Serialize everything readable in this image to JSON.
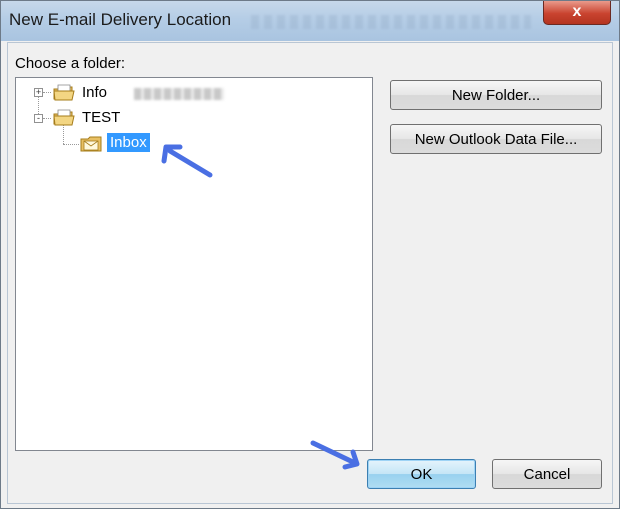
{
  "window": {
    "title": "New E-mail Delivery Location",
    "close_label": "x"
  },
  "folder_panel": {
    "label": "Choose a folder:",
    "tree": [
      {
        "label": "Info",
        "expander": "+",
        "expanded": false
      },
      {
        "label": "TEST",
        "expander": "-",
        "expanded": true,
        "children": [
          {
            "label": "Inbox",
            "selected": true
          }
        ]
      }
    ]
  },
  "buttons": {
    "new_folder": "New Folder...",
    "new_data_file": "New Outlook Data File...",
    "ok": "OK",
    "cancel": "Cancel"
  },
  "colors": {
    "selection": "#3399ff",
    "annotation_arrow": "#4a6fe3",
    "titlebar": "#b5cde6"
  }
}
